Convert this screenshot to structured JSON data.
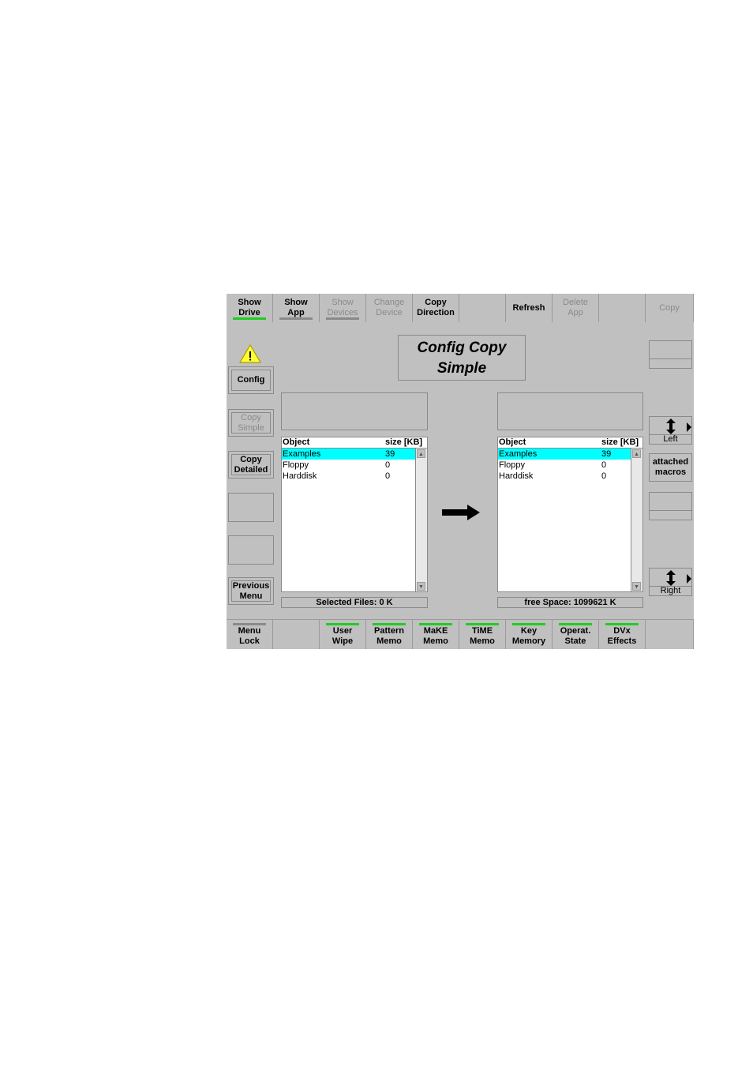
{
  "top_bar": [
    {
      "label": "Show\nDrive",
      "enabled": true,
      "indicator": "green"
    },
    {
      "label": "Show\nApp",
      "enabled": true,
      "indicator": "grey"
    },
    {
      "label": "Show\nDevices",
      "enabled": false,
      "indicator": "grey"
    },
    {
      "label": "Change\nDevice",
      "enabled": false,
      "indicator": "none"
    },
    {
      "label": "Copy\nDirection",
      "enabled": true,
      "indicator": "none"
    },
    {
      "label": "",
      "enabled": false,
      "indicator": "none"
    },
    {
      "label": "Refresh",
      "enabled": true,
      "indicator": "none"
    },
    {
      "label": "Delete\nApp",
      "enabled": false,
      "indicator": "none"
    },
    {
      "label": "",
      "enabled": false,
      "indicator": "none"
    },
    {
      "label": "Copy",
      "enabled": false,
      "indicator": "none"
    }
  ],
  "title": {
    "line1": "Config Copy",
    "line2": "Simple"
  },
  "left_menu": {
    "config": "Config",
    "copy_simple": "Copy\nSimple",
    "copy_detailed": "Copy\nDetailed",
    "previous_menu": "Previous\nMenu"
  },
  "right_menu": {
    "left_label": "Left",
    "attached_macros": "attached\nmacros",
    "right_label": "Right"
  },
  "source_list": {
    "col_object": "Object",
    "col_size": "size [KB]",
    "rows": [
      {
        "name": "Examples",
        "size": "39",
        "selected": true
      },
      {
        "name": "Floppy",
        "size": "0",
        "selected": false
      },
      {
        "name": "Harddisk",
        "size": "0",
        "selected": false
      }
    ],
    "status": "Selected Files:  0 K"
  },
  "target_list": {
    "col_object": "Object",
    "col_size": "size [KB]",
    "rows": [
      {
        "name": "Examples",
        "size": "39",
        "selected": true
      },
      {
        "name": "Floppy",
        "size": "0",
        "selected": false
      },
      {
        "name": "Harddisk",
        "size": "0",
        "selected": false
      }
    ],
    "status": "free Space:  1099621 K"
  },
  "bottom_bar": [
    {
      "label": "Menu\nLock",
      "indicator": "grey"
    },
    {
      "label": "",
      "indicator": "none"
    },
    {
      "label": "User\nWipe",
      "indicator": "green"
    },
    {
      "label": "Pattern\nMemo",
      "indicator": "green"
    },
    {
      "label": "MaKE\nMemo",
      "indicator": "green"
    },
    {
      "label": "TiME\nMemo",
      "indicator": "green"
    },
    {
      "label": "Key\nMemory",
      "indicator": "green"
    },
    {
      "label": "Operat.\nState",
      "indicator": "green"
    },
    {
      "label": "DVx\nEffects",
      "indicator": "green"
    },
    {
      "label": "",
      "indicator": "none"
    }
  ],
  "colors": {
    "panel": "#c0c0c0",
    "selection": "#00ffff",
    "indicator_green": "#22cc22",
    "warning": "#ffff33"
  }
}
